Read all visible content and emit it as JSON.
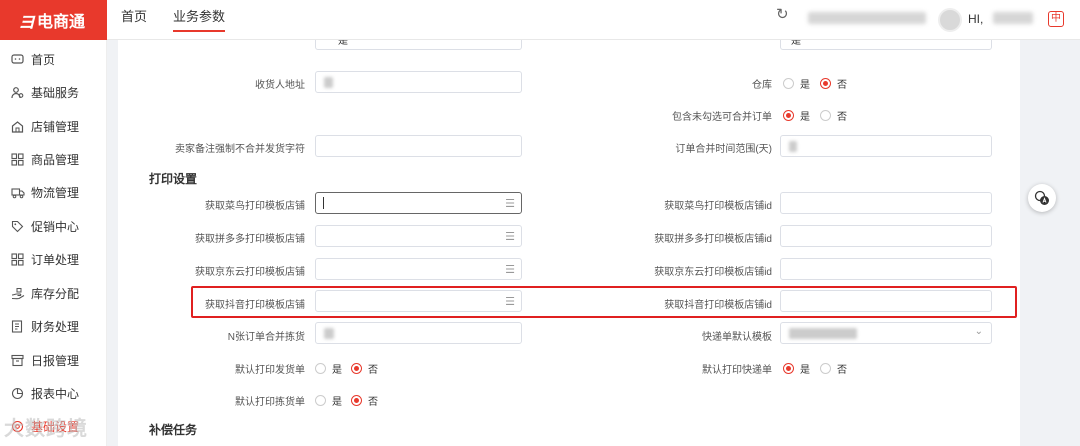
{
  "app": {
    "logo_mark": "ヨ",
    "logo_text": "电商通"
  },
  "header": {
    "tabs": [
      {
        "label": "首页",
        "active": false
      },
      {
        "label": "业务参数",
        "active": true
      }
    ],
    "greeting": "HI,",
    "lang_badge": "中"
  },
  "sidebar": {
    "items": [
      {
        "label": "首页",
        "icon": "message-icon"
      },
      {
        "label": "基础服务",
        "icon": "users-icon"
      },
      {
        "label": "店铺管理",
        "icon": "store-icon"
      },
      {
        "label": "商品管理",
        "icon": "grid-icon"
      },
      {
        "label": "物流管理",
        "icon": "truck-icon"
      },
      {
        "label": "促销中心",
        "icon": "tag-icon"
      },
      {
        "label": "订单处理",
        "icon": "grid-icon"
      },
      {
        "label": "库存分配",
        "icon": "hand-icon"
      },
      {
        "label": "财务处理",
        "icon": "ledger-icon"
      },
      {
        "label": "日报管理",
        "icon": "archive-icon"
      },
      {
        "label": "报表中心",
        "icon": "chart-icon"
      },
      {
        "label": "基础设置",
        "icon": "settings-icon"
      }
    ],
    "watermark": "大数跨境"
  },
  "form": {
    "top_partial_left_value": "是",
    "top_partial_right_value": "是",
    "receiver_address_label": "收货人地址",
    "warehouse_label": "仓库",
    "warehouse_yes": "是",
    "warehouse_no": "否",
    "include_unchecked_label": "包含未勾选可合并订单",
    "include_yes": "是",
    "include_no": "否",
    "seller_note_label": "卖家备注强制不合并发货字符",
    "merge_time_label": "订单合并时间范围(天)",
    "print_section_title": "打印设置",
    "cainiao_shop_label": "获取菜鸟打印模板店铺",
    "cainiao_shop_id_label": "获取菜鸟打印模板店铺id",
    "pdd_shop_label": "获取拼多多打印模板店铺",
    "pdd_shop_id_label": "获取拼多多打印模板店铺id",
    "jd_shop_label": "获取京东云打印模板店铺",
    "jd_shop_id_label": "获取京东云打印模板店铺id",
    "douyin_shop_label": "获取抖音打印模板店铺",
    "douyin_shop_id_label": "获取抖音打印模板店铺id",
    "n_orders_label": "N张订单合并拣货",
    "express_default_label": "快递单默认模板",
    "print_delivery_label": "默认打印发货单",
    "print_delivery_yes": "是",
    "print_delivery_no": "否",
    "print_express_label": "默认打印快递单",
    "print_express_yes": "是",
    "print_express_no": "否",
    "print_picking_label": "默认打印拣货单",
    "print_picking_yes": "是",
    "print_picking_no": "否",
    "compensation_section_title": "补偿任务"
  },
  "colors": {
    "brand": "#e8392c",
    "highlight": "#e02020"
  }
}
